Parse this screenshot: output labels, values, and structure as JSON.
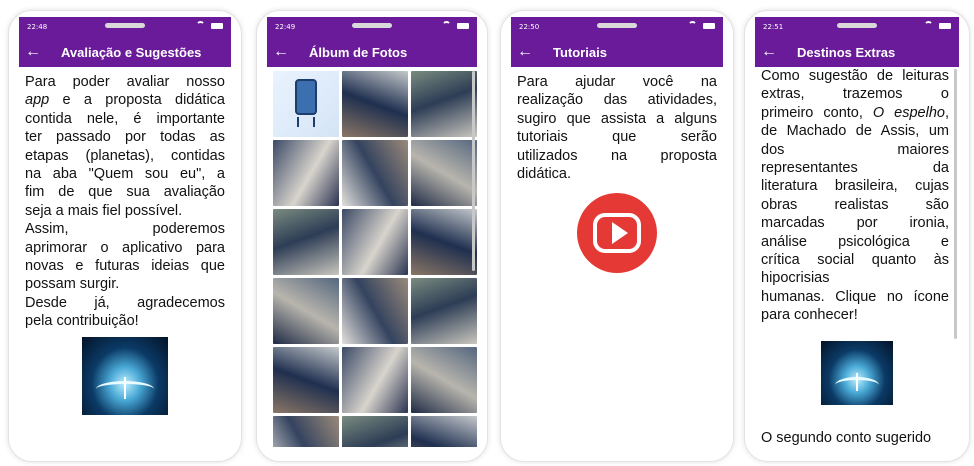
{
  "screens": [
    {
      "time": "22:48",
      "title": "Avaliação e Sugestões",
      "lines": [
        "Para poder avaliar nosso",
        "app e a proposta didática",
        "contida nele, é importante",
        "ter passado por todas as",
        "etapas (planetas), contidas",
        "na aba \"Quem sou eu\", a",
        "fim de que sua avaliação",
        "seja a mais fiel possível.",
        "Assim, poderemos",
        "aprimorar o aplicativo para",
        "novas e futuras ideias que",
        "possam surgir.",
        "Desde já, agradecemos",
        "pela contribuição!"
      ],
      "icon": "book-icon"
    },
    {
      "time": "22:49",
      "title": "Álbum de Fotos",
      "icon": "photo-grid"
    },
    {
      "time": "22:50",
      "title": "Tutoriais",
      "lines": [
        "Para ajudar você na",
        "realização das atividades,",
        "sugiro que assista a alguns",
        "tutoriais que serão",
        "utilizados na proposta",
        "didática."
      ],
      "icon": "youtube-icon"
    },
    {
      "time": "22:51",
      "title": "Destinos Extras",
      "lines": [
        "Como sugestão de leituras",
        "extras, trazemos o",
        "primeiro conto, O espelho,",
        "de Machado de Assis, um",
        "dos maiores",
        "representantes da",
        "literatura brasileira, cujas",
        "obras realistas são",
        "marcadas por ironia,",
        "análise psicológica e",
        "crítica social quanto às",
        "hipocrisias",
        "humanas. Clique no ícone",
        "para conhecer!"
      ],
      "footer": "O segundo conto sugerido",
      "icon": "book-icon"
    }
  ],
  "colors": {
    "appbar": "#6a1b9a",
    "accent_red": "#e53935"
  }
}
